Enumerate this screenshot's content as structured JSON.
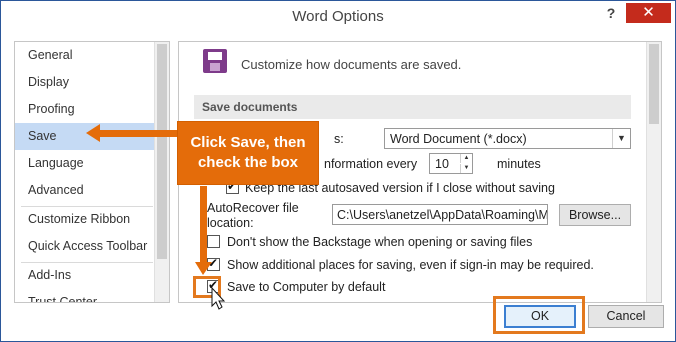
{
  "window": {
    "title": "Word Options",
    "help_glyph": "?",
    "close_glyph": "✕"
  },
  "sidebar": {
    "items": [
      {
        "label": "General"
      },
      {
        "label": "Display"
      },
      {
        "label": "Proofing"
      },
      {
        "label": "Save",
        "active": true
      },
      {
        "label": "Language"
      },
      {
        "label": "Advanced"
      },
      {
        "label": "Customize Ribbon"
      },
      {
        "label": "Quick Access Toolbar"
      },
      {
        "label": "Add-Ins"
      },
      {
        "label": "Trust Center"
      }
    ]
  },
  "content": {
    "header_text": "Customize how documents are saved.",
    "section_title": "Save documents",
    "format_label_tail": "s:",
    "format_value": "Word Document (*.docx)",
    "autorecover_label_tail": "nformation every",
    "autorecover_minutes": "10",
    "minutes_label": "minutes",
    "keep_last_label": "Keep the last autosaved version if I close without saving",
    "keep_last_checked": true,
    "autorecover_location_label_1": "AutoRecover file",
    "autorecover_location_label_2": "location:",
    "autorecover_path": "C:\\Users\\anetzel\\AppData\\Roaming\\Mi",
    "browse_label": "Browse...",
    "backstage_label": "Don't show the Backstage when opening or saving files",
    "backstage_checked": false,
    "additional_places_label": "Show additional places for saving, even if sign-in may be required.",
    "additional_places_checked": true,
    "save_to_computer_label": "Save to Computer by default",
    "save_to_computer_checked": true
  },
  "footer": {
    "ok_label": "OK",
    "cancel_label": "Cancel"
  },
  "callout": {
    "line1": "Click Save, then",
    "line2": "check the box"
  },
  "colors": {
    "accent": "#e46c0a",
    "selection": "#c5daf4",
    "close": "#c42b1c"
  }
}
